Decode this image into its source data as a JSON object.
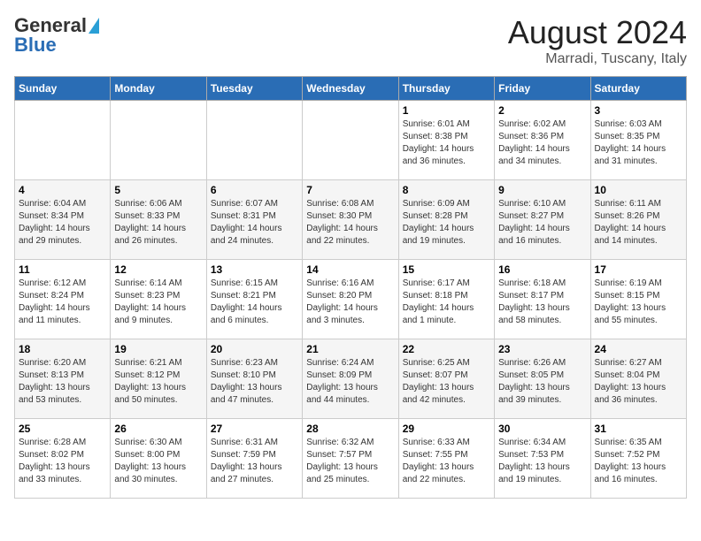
{
  "logo": {
    "general": "General",
    "blue": "Blue"
  },
  "header": {
    "title": "August 2024",
    "subtitle": "Marradi, Tuscany, Italy"
  },
  "weekdays": [
    "Sunday",
    "Monday",
    "Tuesday",
    "Wednesday",
    "Thursday",
    "Friday",
    "Saturday"
  ],
  "weeks": [
    [
      {
        "num": "",
        "info": ""
      },
      {
        "num": "",
        "info": ""
      },
      {
        "num": "",
        "info": ""
      },
      {
        "num": "",
        "info": ""
      },
      {
        "num": "1",
        "info": "Sunrise: 6:01 AM\nSunset: 8:38 PM\nDaylight: 14 hours and 36 minutes."
      },
      {
        "num": "2",
        "info": "Sunrise: 6:02 AM\nSunset: 8:36 PM\nDaylight: 14 hours and 34 minutes."
      },
      {
        "num": "3",
        "info": "Sunrise: 6:03 AM\nSunset: 8:35 PM\nDaylight: 14 hours and 31 minutes."
      }
    ],
    [
      {
        "num": "4",
        "info": "Sunrise: 6:04 AM\nSunset: 8:34 PM\nDaylight: 14 hours and 29 minutes."
      },
      {
        "num": "5",
        "info": "Sunrise: 6:06 AM\nSunset: 8:33 PM\nDaylight: 14 hours and 26 minutes."
      },
      {
        "num": "6",
        "info": "Sunrise: 6:07 AM\nSunset: 8:31 PM\nDaylight: 14 hours and 24 minutes."
      },
      {
        "num": "7",
        "info": "Sunrise: 6:08 AM\nSunset: 8:30 PM\nDaylight: 14 hours and 22 minutes."
      },
      {
        "num": "8",
        "info": "Sunrise: 6:09 AM\nSunset: 8:28 PM\nDaylight: 14 hours and 19 minutes."
      },
      {
        "num": "9",
        "info": "Sunrise: 6:10 AM\nSunset: 8:27 PM\nDaylight: 14 hours and 16 minutes."
      },
      {
        "num": "10",
        "info": "Sunrise: 6:11 AM\nSunset: 8:26 PM\nDaylight: 14 hours and 14 minutes."
      }
    ],
    [
      {
        "num": "11",
        "info": "Sunrise: 6:12 AM\nSunset: 8:24 PM\nDaylight: 14 hours and 11 minutes."
      },
      {
        "num": "12",
        "info": "Sunrise: 6:14 AM\nSunset: 8:23 PM\nDaylight: 14 hours and 9 minutes."
      },
      {
        "num": "13",
        "info": "Sunrise: 6:15 AM\nSunset: 8:21 PM\nDaylight: 14 hours and 6 minutes."
      },
      {
        "num": "14",
        "info": "Sunrise: 6:16 AM\nSunset: 8:20 PM\nDaylight: 14 hours and 3 minutes."
      },
      {
        "num": "15",
        "info": "Sunrise: 6:17 AM\nSunset: 8:18 PM\nDaylight: 14 hours and 1 minute."
      },
      {
        "num": "16",
        "info": "Sunrise: 6:18 AM\nSunset: 8:17 PM\nDaylight: 13 hours and 58 minutes."
      },
      {
        "num": "17",
        "info": "Sunrise: 6:19 AM\nSunset: 8:15 PM\nDaylight: 13 hours and 55 minutes."
      }
    ],
    [
      {
        "num": "18",
        "info": "Sunrise: 6:20 AM\nSunset: 8:13 PM\nDaylight: 13 hours and 53 minutes."
      },
      {
        "num": "19",
        "info": "Sunrise: 6:21 AM\nSunset: 8:12 PM\nDaylight: 13 hours and 50 minutes."
      },
      {
        "num": "20",
        "info": "Sunrise: 6:23 AM\nSunset: 8:10 PM\nDaylight: 13 hours and 47 minutes."
      },
      {
        "num": "21",
        "info": "Sunrise: 6:24 AM\nSunset: 8:09 PM\nDaylight: 13 hours and 44 minutes."
      },
      {
        "num": "22",
        "info": "Sunrise: 6:25 AM\nSunset: 8:07 PM\nDaylight: 13 hours and 42 minutes."
      },
      {
        "num": "23",
        "info": "Sunrise: 6:26 AM\nSunset: 8:05 PM\nDaylight: 13 hours and 39 minutes."
      },
      {
        "num": "24",
        "info": "Sunrise: 6:27 AM\nSunset: 8:04 PM\nDaylight: 13 hours and 36 minutes."
      }
    ],
    [
      {
        "num": "25",
        "info": "Sunrise: 6:28 AM\nSunset: 8:02 PM\nDaylight: 13 hours and 33 minutes."
      },
      {
        "num": "26",
        "info": "Sunrise: 6:30 AM\nSunset: 8:00 PM\nDaylight: 13 hours and 30 minutes."
      },
      {
        "num": "27",
        "info": "Sunrise: 6:31 AM\nSunset: 7:59 PM\nDaylight: 13 hours and 27 minutes."
      },
      {
        "num": "28",
        "info": "Sunrise: 6:32 AM\nSunset: 7:57 PM\nDaylight: 13 hours and 25 minutes."
      },
      {
        "num": "29",
        "info": "Sunrise: 6:33 AM\nSunset: 7:55 PM\nDaylight: 13 hours and 22 minutes."
      },
      {
        "num": "30",
        "info": "Sunrise: 6:34 AM\nSunset: 7:53 PM\nDaylight: 13 hours and 19 minutes."
      },
      {
        "num": "31",
        "info": "Sunrise: 6:35 AM\nSunset: 7:52 PM\nDaylight: 13 hours and 16 minutes."
      }
    ]
  ]
}
